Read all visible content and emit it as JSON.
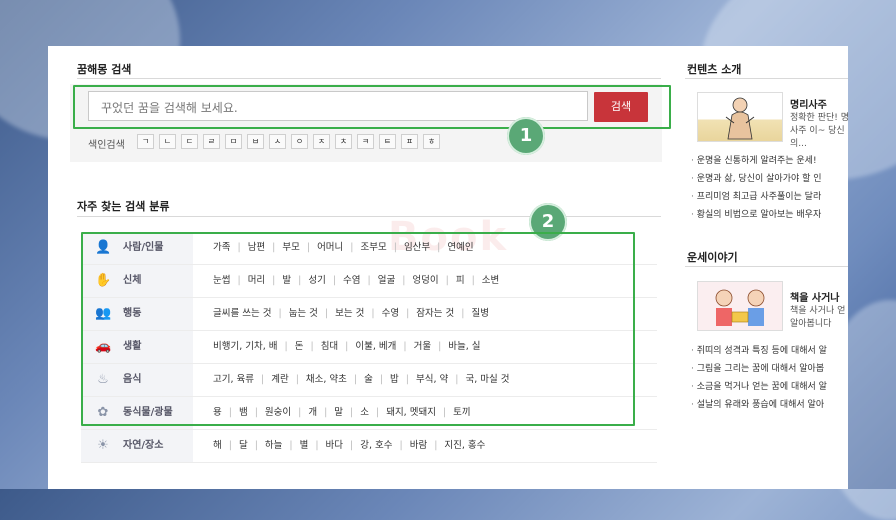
{
  "search_section": {
    "title": "꿈해몽 검색",
    "placeholder": "꾸었던 꿈을 검색해 보세요.",
    "button_label": "검색",
    "index_label": "색인검색",
    "index_keys": [
      "ㄱ",
      "ㄴ",
      "ㄷ",
      "ㄹ",
      "ㅁ",
      "ㅂ",
      "ㅅ",
      "ㅇ",
      "ㅈ",
      "ㅊ",
      "ㅋ",
      "ㅌ",
      "ㅍ",
      "ㅎ"
    ]
  },
  "categories_section": {
    "title": "자주 찾는 검색 분류",
    "rows": [
      {
        "name": "사람/인물",
        "icon": "person-icon",
        "items": [
          "가족",
          "남편",
          "부모",
          "어머니",
          "조부모",
          "임산부",
          "연예인"
        ]
      },
      {
        "name": "신체",
        "icon": "body-icon",
        "items": [
          "눈썹",
          "머리",
          "발",
          "성기",
          "수염",
          "얼굴",
          "엉덩이",
          "피",
          "소변"
        ]
      },
      {
        "name": "행동",
        "icon": "people-icon",
        "items": [
          "글씨를 쓰는 것",
          "눕는 것",
          "보는 것",
          "수영",
          "잠자는 것",
          "질병"
        ]
      },
      {
        "name": "생활",
        "icon": "car-icon",
        "items": [
          "비행기, 기차, 배",
          "돈",
          "침대",
          "이불, 베개",
          "거울",
          "바늘, 실"
        ]
      },
      {
        "name": "음식",
        "icon": "bowl-icon",
        "items": [
          "고기, 육류",
          "계란",
          "채소, 약초",
          "술",
          "밥",
          "부식, 약",
          "국, 마실 것"
        ]
      },
      {
        "name": "동식물/광물",
        "icon": "plant-icon",
        "items": [
          "용",
          "뱀",
          "원숭이",
          "개",
          "말",
          "소",
          "돼지, 멧돼지",
          "토끼"
        ]
      },
      {
        "name": "자연/장소",
        "icon": "sun-icon",
        "items": [
          "해",
          "달",
          "하늘",
          "별",
          "바다",
          "강, 호수",
          "바람",
          "지진, 홍수"
        ]
      }
    ]
  },
  "watermark": "Book",
  "annotations": {
    "badge1": "1",
    "badge2": "2"
  },
  "sidebar": {
    "contents_title": "컨텐츠 소개",
    "feature1": {
      "title": "명리사주",
      "desc": "정확한 판단! 명리사주 이~ 당신의..."
    },
    "list1": [
      "운명을 신통하게 알려주는 운세!",
      "운명과 삶, 당신이 살아가야 할 인",
      "프리미엄 최고급 사주풀이는 달라",
      "황실의 비법으로 알아보는 배우자"
    ],
    "fortune_title": "운세이야기",
    "feature2": {
      "title": "책을 사거나",
      "desc": "책을 사거나 얻 서 알아봅니다"
    },
    "list2": [
      "쥐띠의 성격과 특징 등에 대해서 알",
      "그림을 그리는 꿈에 대해서 알아봅",
      "소금을 먹거나 얻는 꿈에 대해서 알",
      "설날의 유래와 풍습에 대해서 알아"
    ]
  },
  "colors": {
    "accent_red": "#c8343a",
    "annotation_green": "#3aae4a",
    "badge_green": "#5aa876"
  }
}
